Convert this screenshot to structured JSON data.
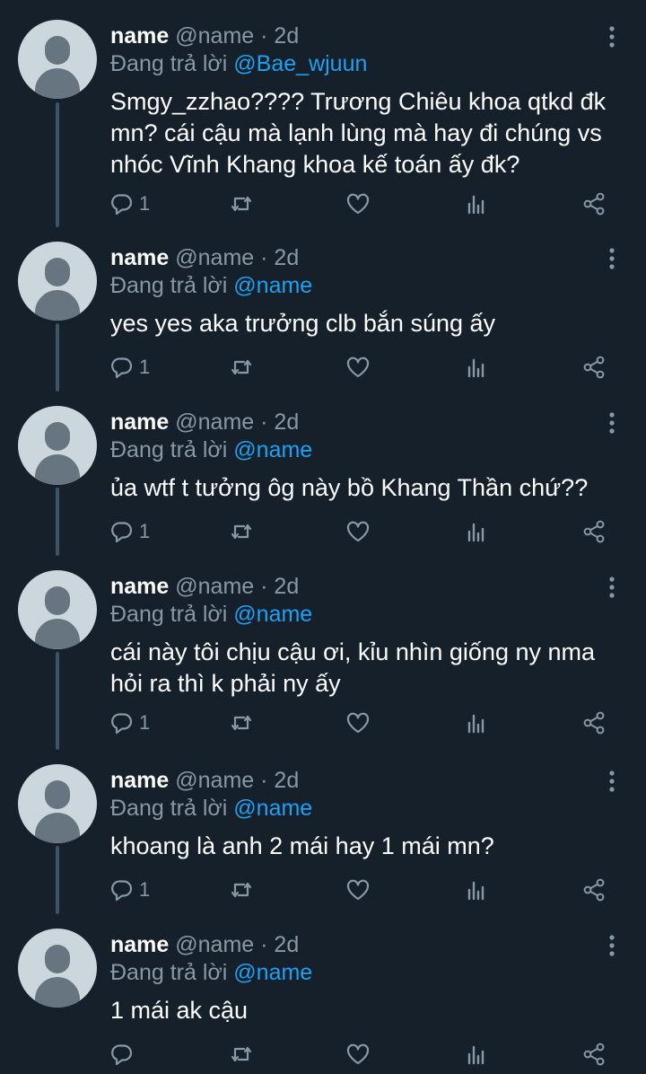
{
  "colors": {
    "background": "#15202b",
    "text": "#ffffff",
    "muted": "#8899a6",
    "mention": "#1da1f2",
    "thread_line": "#3d5466",
    "avatar_bg": "#ccd6dd",
    "avatar_fg": "#66757f"
  },
  "icons": {
    "reply": "reply-icon",
    "retweet": "retweet-icon",
    "like": "heart-icon",
    "stats": "stats-icon",
    "share": "share-icon",
    "more": "more-vertical-icon",
    "avatar": "default-avatar-icon"
  },
  "tweets": [
    {
      "display_name": "name",
      "handle": "@name",
      "separator": "·",
      "time": "2d",
      "replying_label": "Đang trả lời",
      "replying_to": "@Bae_wjuun",
      "text": "Smgy_zzhao???? Trương Chiêu khoa qtkd đk mn? cái cậu mà lạnh lùng mà hay đi chúng vs nhóc Vĩnh Khang khoa kế toán ấy đk?",
      "reply_count": "1"
    },
    {
      "display_name": "name",
      "handle": "@name",
      "separator": "·",
      "time": "2d",
      "replying_label": "Đang trả lời",
      "replying_to": "@name",
      "text": "yes yes aka trưởng clb bắn súng ấy",
      "reply_count": "1"
    },
    {
      "display_name": "name",
      "handle": "@name",
      "separator": "·",
      "time": "2d",
      "replying_label": "Đang trả lời",
      "replying_to": "@name",
      "text": "ủa wtf t tưởng ôg này bồ Khang Thần chứ??",
      "reply_count": "1"
    },
    {
      "display_name": "name",
      "handle": "@name",
      "separator": "·",
      "time": "2d",
      "replying_label": "Đang trả lời",
      "replying_to": "@name",
      "text": "cái này tôi chịu cậu ơi, kỉu nhìn giống ny nma hỏi ra thì k phải ny ấy",
      "reply_count": "1"
    },
    {
      "display_name": "name",
      "handle": "@name",
      "separator": "·",
      "time": "2d",
      "replying_label": "Đang trả lời",
      "replying_to": "@name",
      "text": "khoang là anh 2 mái hay 1 mái mn?",
      "reply_count": "1"
    },
    {
      "display_name": "name",
      "handle": "@name",
      "separator": "·",
      "time": "2d",
      "replying_label": "Đang trả lời",
      "replying_to": "@name",
      "text": "1 mái ak cậu",
      "reply_count": ""
    }
  ]
}
